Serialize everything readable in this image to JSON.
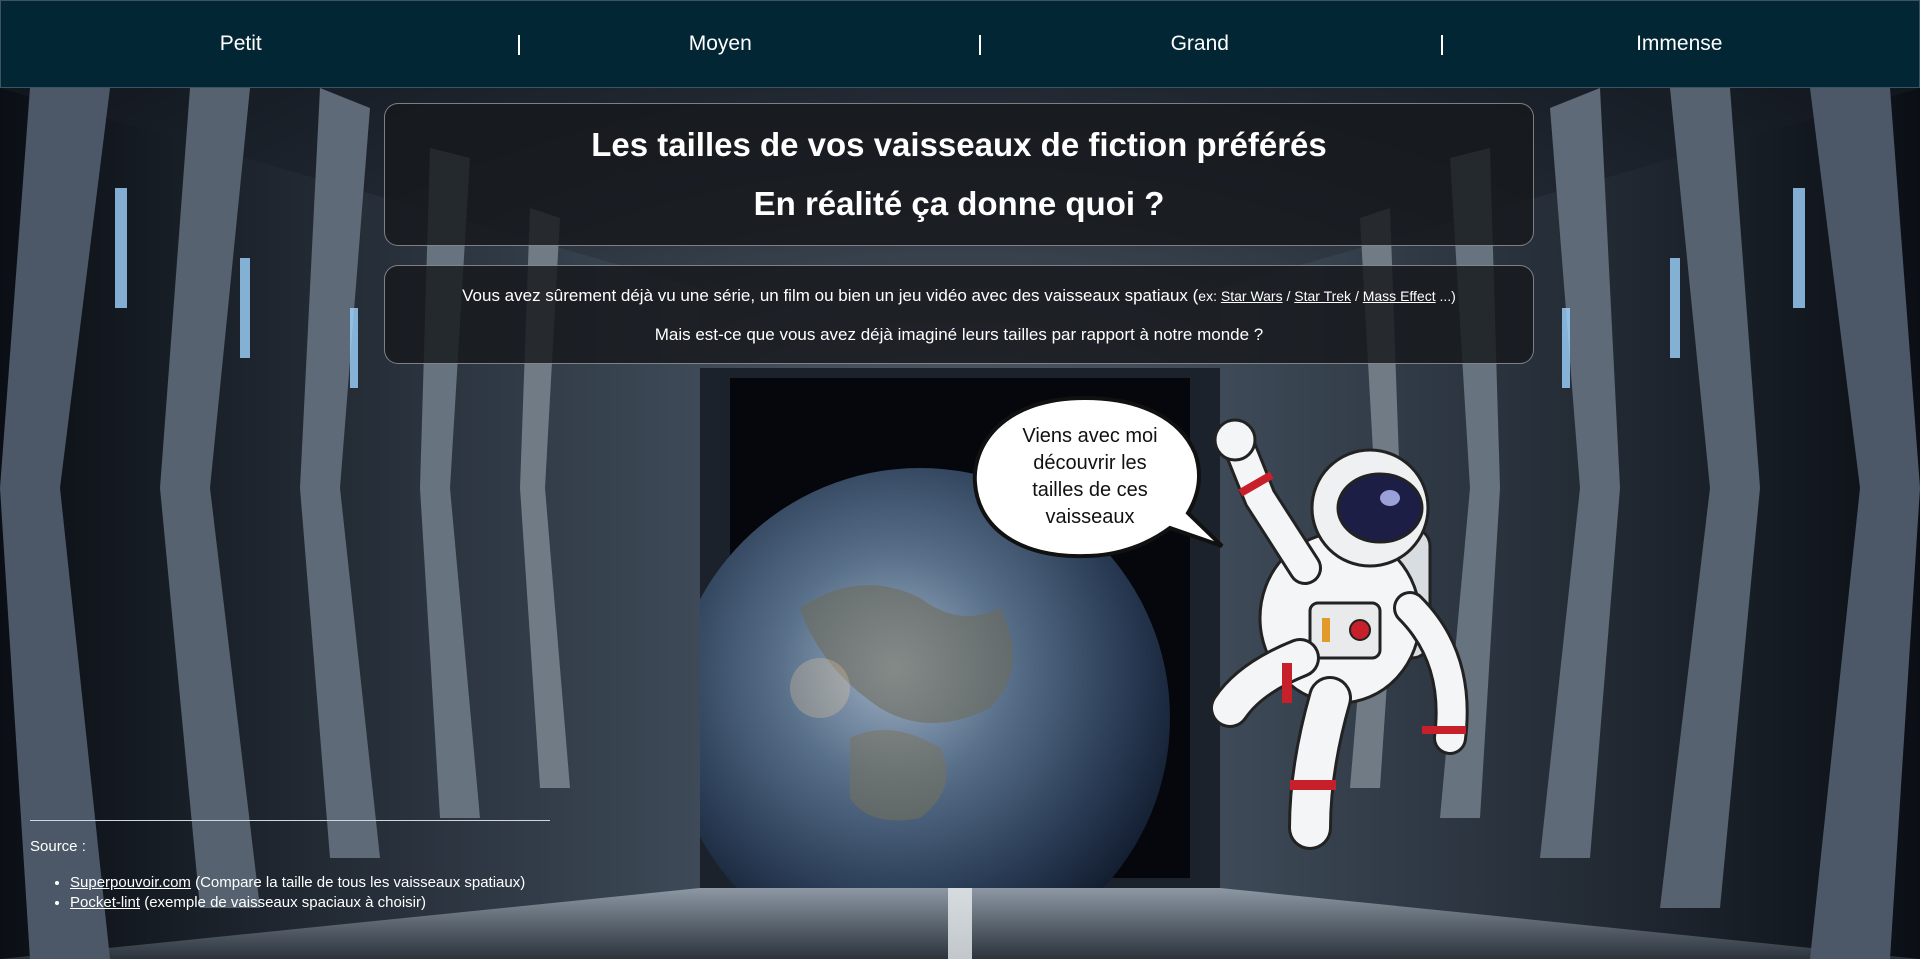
{
  "nav": {
    "items": [
      "Petit",
      "Moyen",
      "Grand",
      "Immense"
    ]
  },
  "header": {
    "title": "Les tailles de vos vaisseaux de fiction préférés",
    "subtitle": "En réalité ça donne quoi ?"
  },
  "intro": {
    "line1_prefix": "Vous avez sûrement déjà vu une série, un film ou bien un jeu vidéo avec des vaisseaux spatiaux (",
    "ex_label": "ex:",
    "link_starwars": "Star Wars",
    "sep1": "/",
    "link_startrek": "Star Trek",
    "sep2": "/",
    "link_masseffect": "Mass Effect",
    "line1_suffix": "...)",
    "line2": "Mais est-ce que vous avez déjà imaginé leurs tailles par rapport à notre monde ?"
  },
  "bubble": {
    "lines": [
      "Viens avec moi",
      "découvrir les",
      "tailles de ces",
      "vaisseaux"
    ]
  },
  "footer": {
    "source_label": "Source :",
    "sources": [
      {
        "link": "Superpouvoir.com",
        "desc": "(Compare la taille de tous les vaisseaux spatiaux)"
      },
      {
        "link": "Pocket-lint",
        "desc": "(exemple de vaisseaux spaciaux à choisir)"
      }
    ]
  },
  "colors": {
    "nav_bg": "#032634",
    "panel_bg": "rgba(22,24,28,0.82)",
    "suit_stripe": "#c8202a"
  },
  "icons": [
    "earth-image",
    "astronaut-illustration",
    "speech-bubble",
    "corridor-background"
  ]
}
